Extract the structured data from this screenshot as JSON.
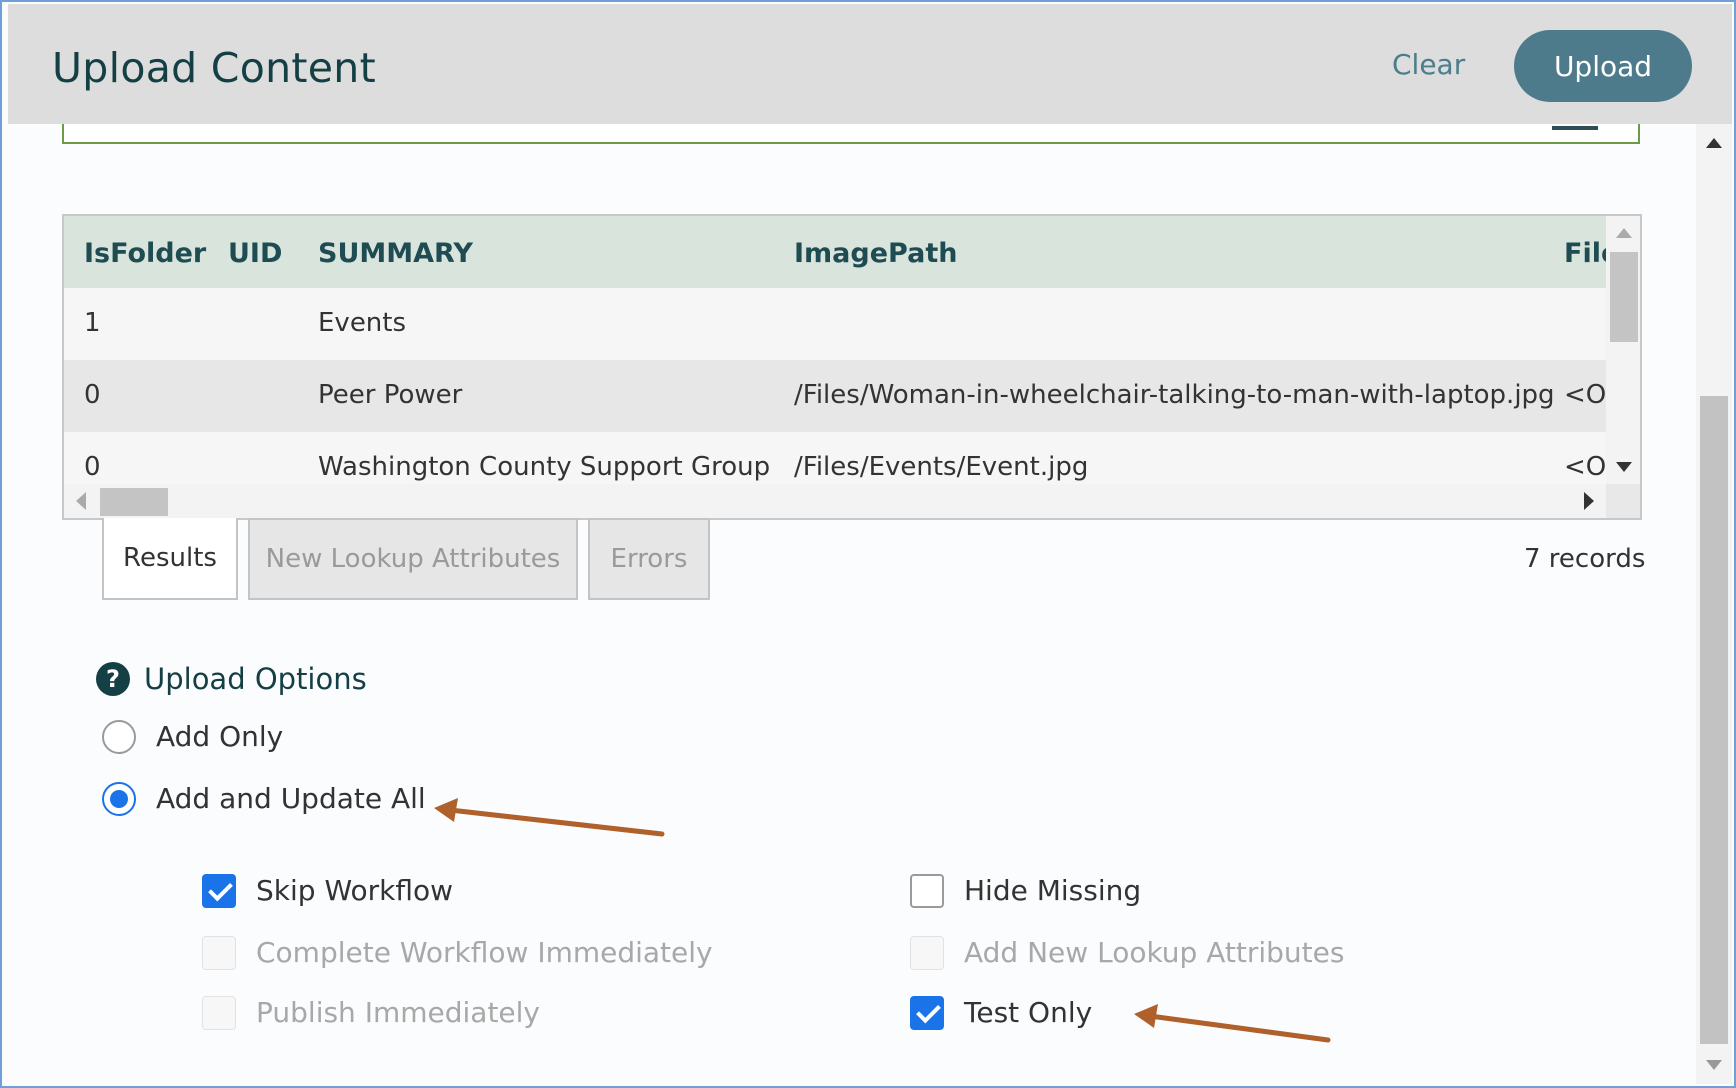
{
  "dialog": {
    "title": "Upload Content",
    "clear_label": "Clear",
    "upload_label": "Upload"
  },
  "grid": {
    "columns": [
      "IsFolder",
      "UID",
      "SUMMARY",
      "ImagePath",
      "File"
    ],
    "rows": [
      {
        "isfolder": "1",
        "uid": "",
        "summary": "Events",
        "imagepath": "",
        "file": ""
      },
      {
        "isfolder": "0",
        "uid": "",
        "summary": "Peer Power",
        "imagepath": "/Files/Woman-in-wheelchair-talking-to-man-with-laptop.jpg",
        "file": "<Op"
      },
      {
        "isfolder": "0",
        "uid": "",
        "summary": "Washington County Support Group",
        "imagepath": "/Files/Events/Event.jpg",
        "file": "<Op"
      }
    ]
  },
  "tabs": {
    "results": "Results",
    "lookup": "New Lookup Attributes",
    "errors": "Errors",
    "records": "7 records"
  },
  "options": {
    "heading": "Upload Options",
    "help_icon": "?",
    "mode": {
      "add_only": "Add Only",
      "add_update_all": "Add and Update All",
      "selected": "add_update_all"
    },
    "checkboxes": {
      "skip_workflow": {
        "label": "Skip Workflow",
        "checked": true,
        "enabled": true
      },
      "complete_workflow": {
        "label": "Complete Workflow Immediately",
        "checked": false,
        "enabled": false
      },
      "publish_immediately": {
        "label": "Publish Immediately",
        "checked": false,
        "enabled": false
      },
      "hide_missing": {
        "label": "Hide Missing",
        "checked": false,
        "enabled": true
      },
      "add_lookup": {
        "label": "Add New Lookup Attributes",
        "checked": false,
        "enabled": false
      },
      "test_only": {
        "label": "Test Only",
        "checked": true,
        "enabled": true
      }
    }
  },
  "colors": {
    "accent": "#1a73e8",
    "title": "#143f45",
    "upload_button": "#4d7b8c",
    "annotation_arrow": "#b0602a"
  }
}
